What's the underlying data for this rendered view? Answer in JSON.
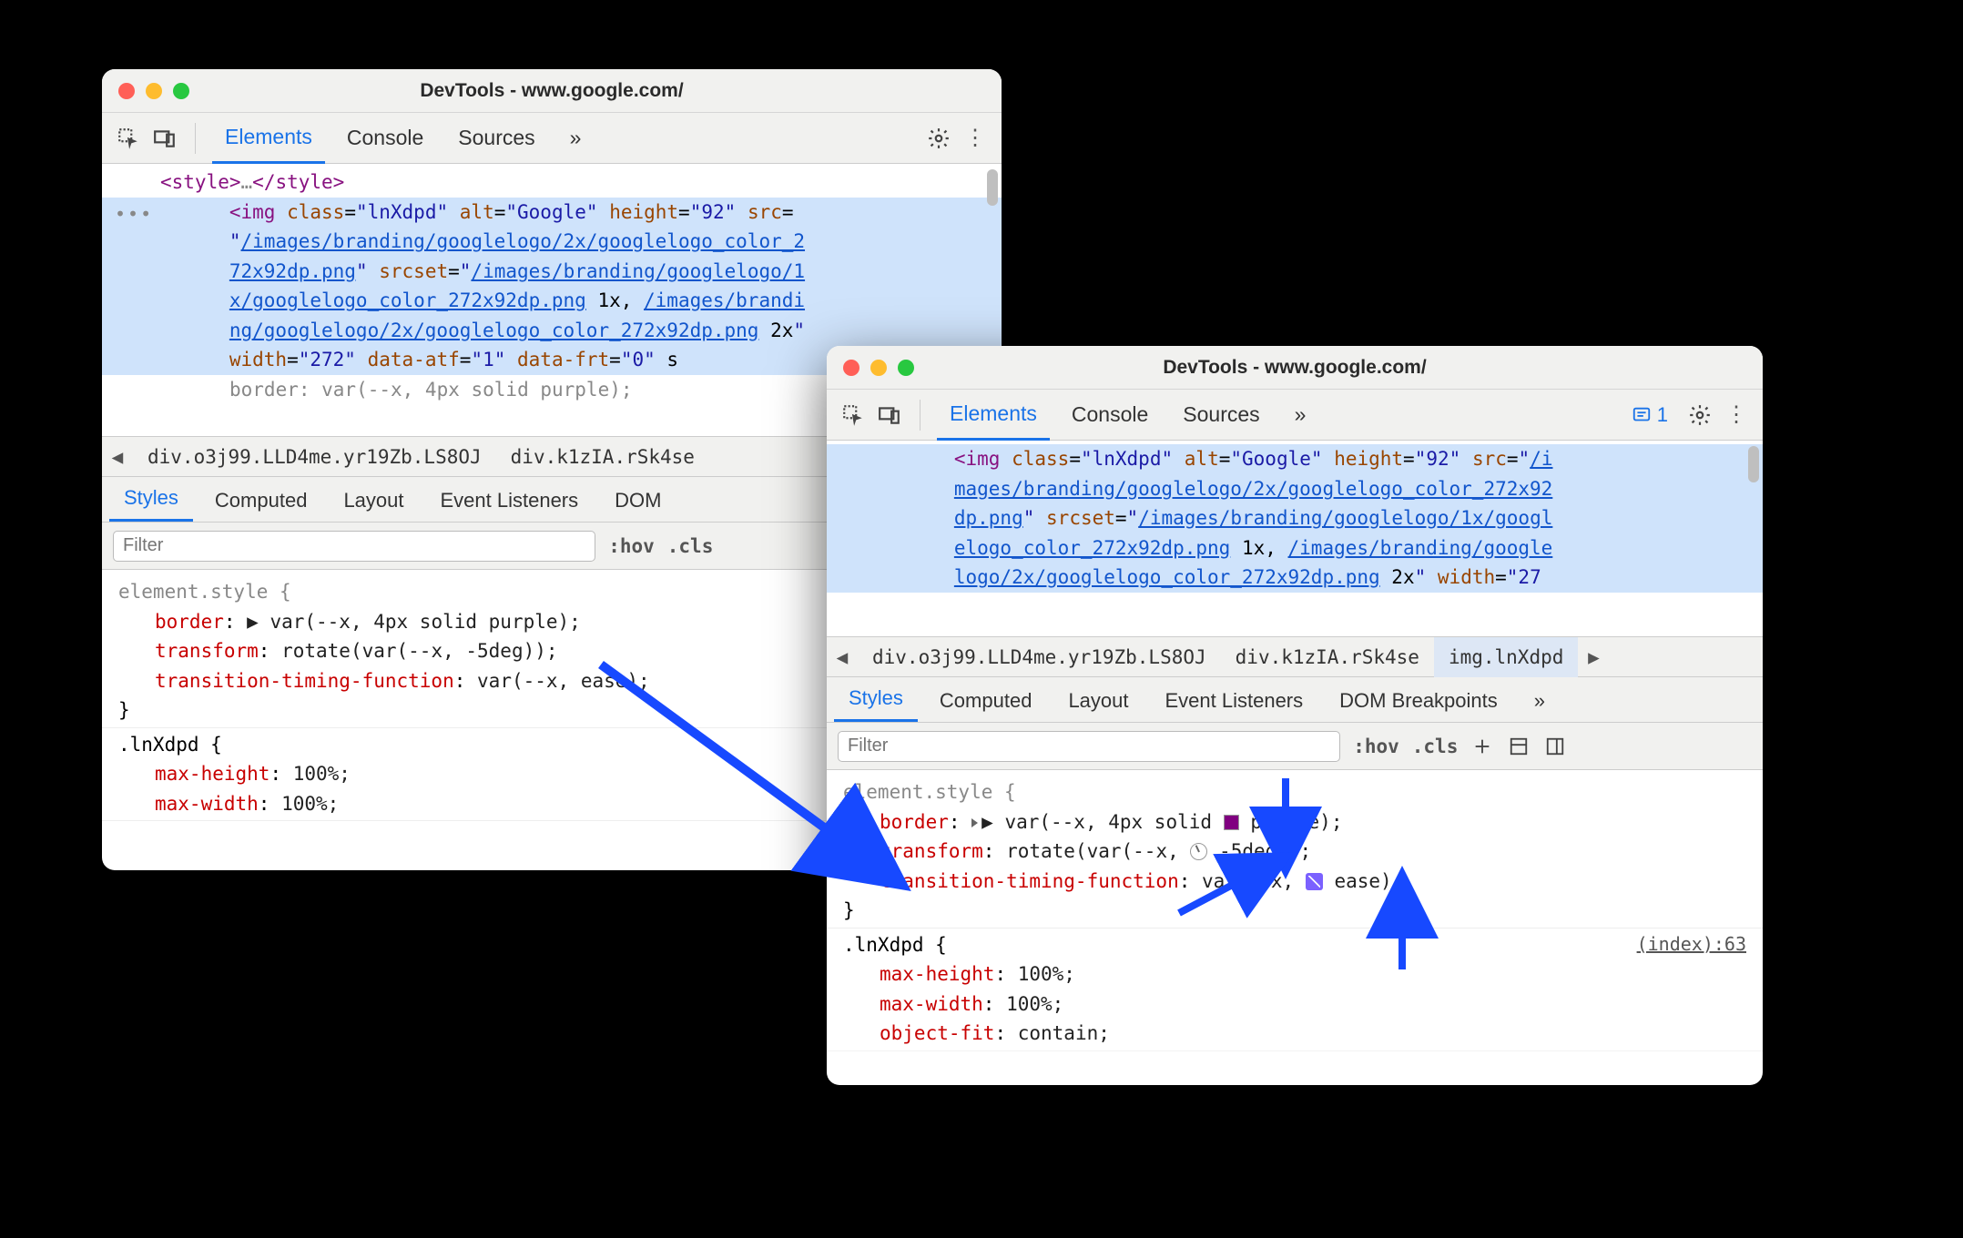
{
  "windows": {
    "left": {
      "title": "DevTools - www.google.com/",
      "tabs": {
        "elements": "Elements",
        "console": "Console",
        "sources": "Sources"
      },
      "dom": {
        "style_close": "<style>…</style>",
        "img_open1": "<img class=\"lnXdpd\" alt=\"Google\" height=\"92\" src=",
        "src_line1": "\"/images/branding/googlelogo/2x/googlelogo_color_2",
        "src_line2": "72x92dp.png\" srcset=\"/images/branding/googlelogo/1",
        "src_line3": "x/googlelogo_color_272x92dp.png 1x, /images/brandi",
        "src_line4": "ng/googlelogo/2x/googlelogo_color_272x92dp.png 2x\"",
        "attrs_last": "width=\"272\" data-atf=\"1\" data-frt=\"0\" s",
        "hint": "border: var(--x, 4px solid purple);"
      },
      "crumbs": {
        "c1": "div.o3j99.LLD4me.yr19Zb.LS8OJ",
        "c2": "div.k1zIA.rSk4se"
      },
      "subtabs": {
        "styles": "Styles",
        "computed": "Computed",
        "layout": "Layout",
        "events": "Event Listeners",
        "dom": "DOM"
      },
      "filter": {
        "placeholder": "Filter",
        "hov": ":hov",
        "cls": ".cls"
      },
      "styles": {
        "elsel": "element.style {",
        "p1": {
          "prop": "border",
          "raw": "▶ var(--x, 4px solid purple);"
        },
        "p2": {
          "prop": "transform",
          "raw": "rotate(var(--x, -5deg));"
        },
        "p3": {
          "prop": "transition-timing-function",
          "raw": "var(--x, ease);"
        },
        "close": "}",
        "rule2_sel": ".lnXdpd {",
        "r2a": {
          "prop": "max-height",
          "val": "100%;"
        },
        "r2b": {
          "prop": "max-width",
          "val": "100%;"
        }
      }
    },
    "right": {
      "title": "DevTools - www.google.com/",
      "tabs": {
        "elements": "Elements",
        "console": "Console",
        "sources": "Sources"
      },
      "issues": "1",
      "dom": {
        "img_open1": "<img class=\"lnXdpd\" alt=\"Google\" height=\"92\" src=\"/i",
        "l2": "mages/branding/googlelogo/2x/googlelogo_color_272x92",
        "l3": "dp.png\" srcset=\"/images/branding/googlelogo/1x/googl",
        "l4": "elogo_color_272x92dp.png 1x, /images/branding/google",
        "l5": "logo/2x/googlelogo_color_272x92dp.png 2x\" width=\"27"
      },
      "crumbs": {
        "c1": "div.o3j99.LLD4me.yr19Zb.LS8OJ",
        "c2": "div.k1zIA.rSk4se",
        "c3": "img.lnXdpd"
      },
      "subtabs": {
        "styles": "Styles",
        "computed": "Computed",
        "layout": "Layout",
        "events": "Event Listeners",
        "dom": "DOM Breakpoints"
      },
      "filter": {
        "placeholder": "Filter",
        "hov": ":hov",
        "cls": ".cls"
      },
      "styles": {
        "elsel": "element.style {",
        "p1": {
          "prop": "border",
          "pre": "▶ var(--x, 4px solid ",
          "suf": "purple);"
        },
        "p2": {
          "prop": "transform",
          "pre": "rotate(var(--x, ",
          "suf": "-5deg));"
        },
        "p3": {
          "prop": "transition-timing-function",
          "pre": "var(--x, ",
          "suf": "ease);"
        },
        "close": "}",
        "source": "(index):63",
        "rule2_sel": ".lnXdpd {",
        "r2a": {
          "prop": "max-height",
          "val": "100%;"
        },
        "r2b": {
          "prop": "max-width",
          "val": "100%;"
        },
        "r2c": {
          "prop": "object-fit",
          "val": "contain;"
        }
      }
    }
  }
}
